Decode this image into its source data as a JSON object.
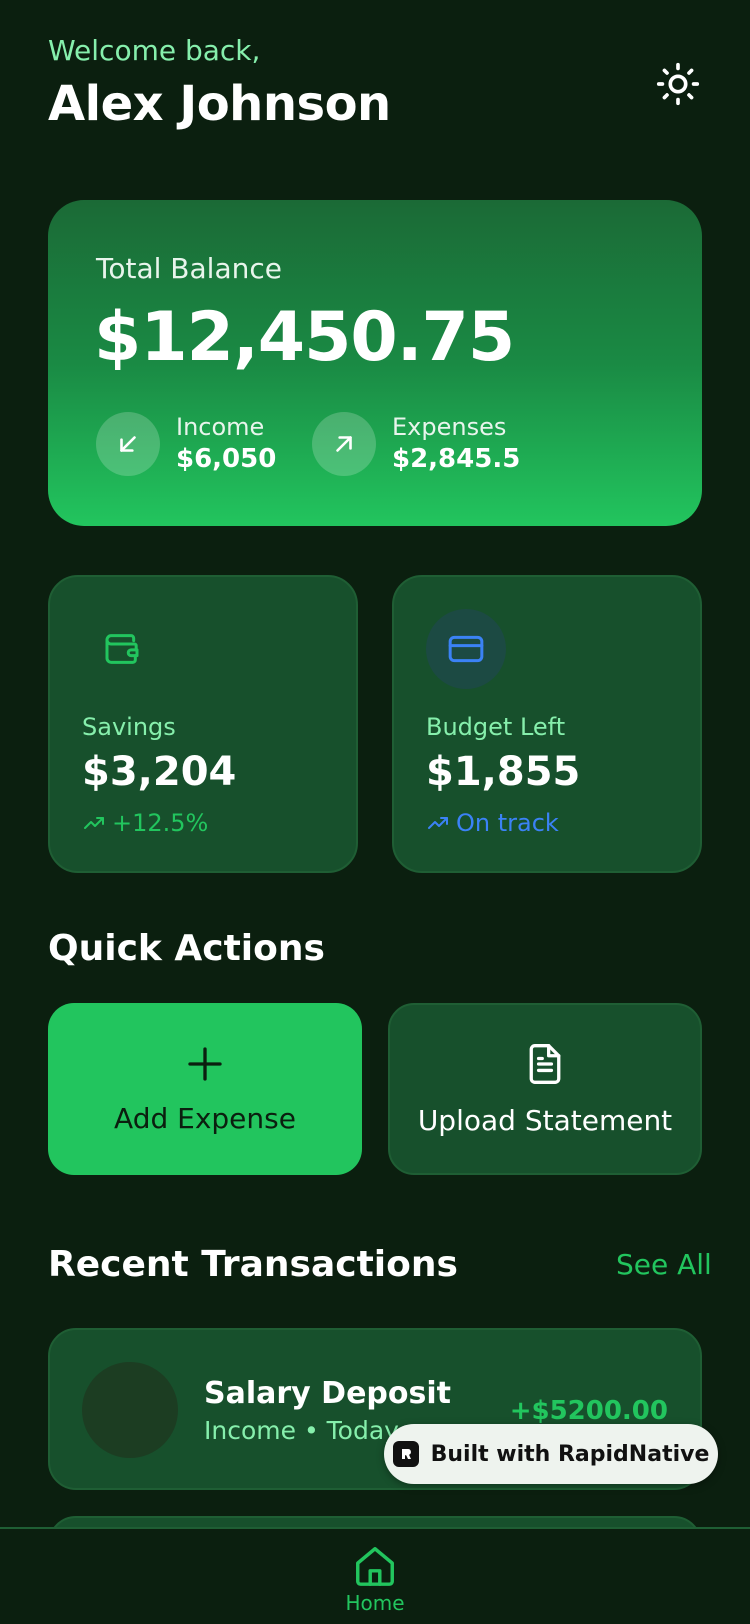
{
  "header": {
    "welcome": "Welcome back,",
    "user_name": "Alex Johnson",
    "theme_icon": "sun-icon"
  },
  "balance": {
    "label": "Total Balance",
    "amount": "$12,450.75",
    "income_label": "Income",
    "income_value": "$6,050",
    "expenses_label": "Expenses",
    "expenses_value": "$2,845.5"
  },
  "stats": {
    "savings": {
      "label": "Savings",
      "value": "$3,204",
      "trend": "+12.5%",
      "icon": "wallet-icon"
    },
    "budget": {
      "label": "Budget Left",
      "value": "$1,855",
      "trend": "On track",
      "icon": "credit-card-icon"
    }
  },
  "quick_actions": {
    "title": "Quick Actions",
    "add_label": "Add Expense",
    "upload_label": "Upload Statement"
  },
  "transactions": {
    "title": "Recent Transactions",
    "see_all": "See All",
    "items": [
      {
        "title": "Salary Deposit",
        "meta": "Income • Today",
        "amount": "+$5200.00"
      }
    ]
  },
  "badge": {
    "text": "Built with RapidNative"
  },
  "tab_bar": {
    "home_label": "Home"
  },
  "colors": {
    "background": "#0b1f0f",
    "card": "#17502c",
    "accent": "#22c55e",
    "accent_light": "#86efac",
    "info": "#3b82f6"
  }
}
